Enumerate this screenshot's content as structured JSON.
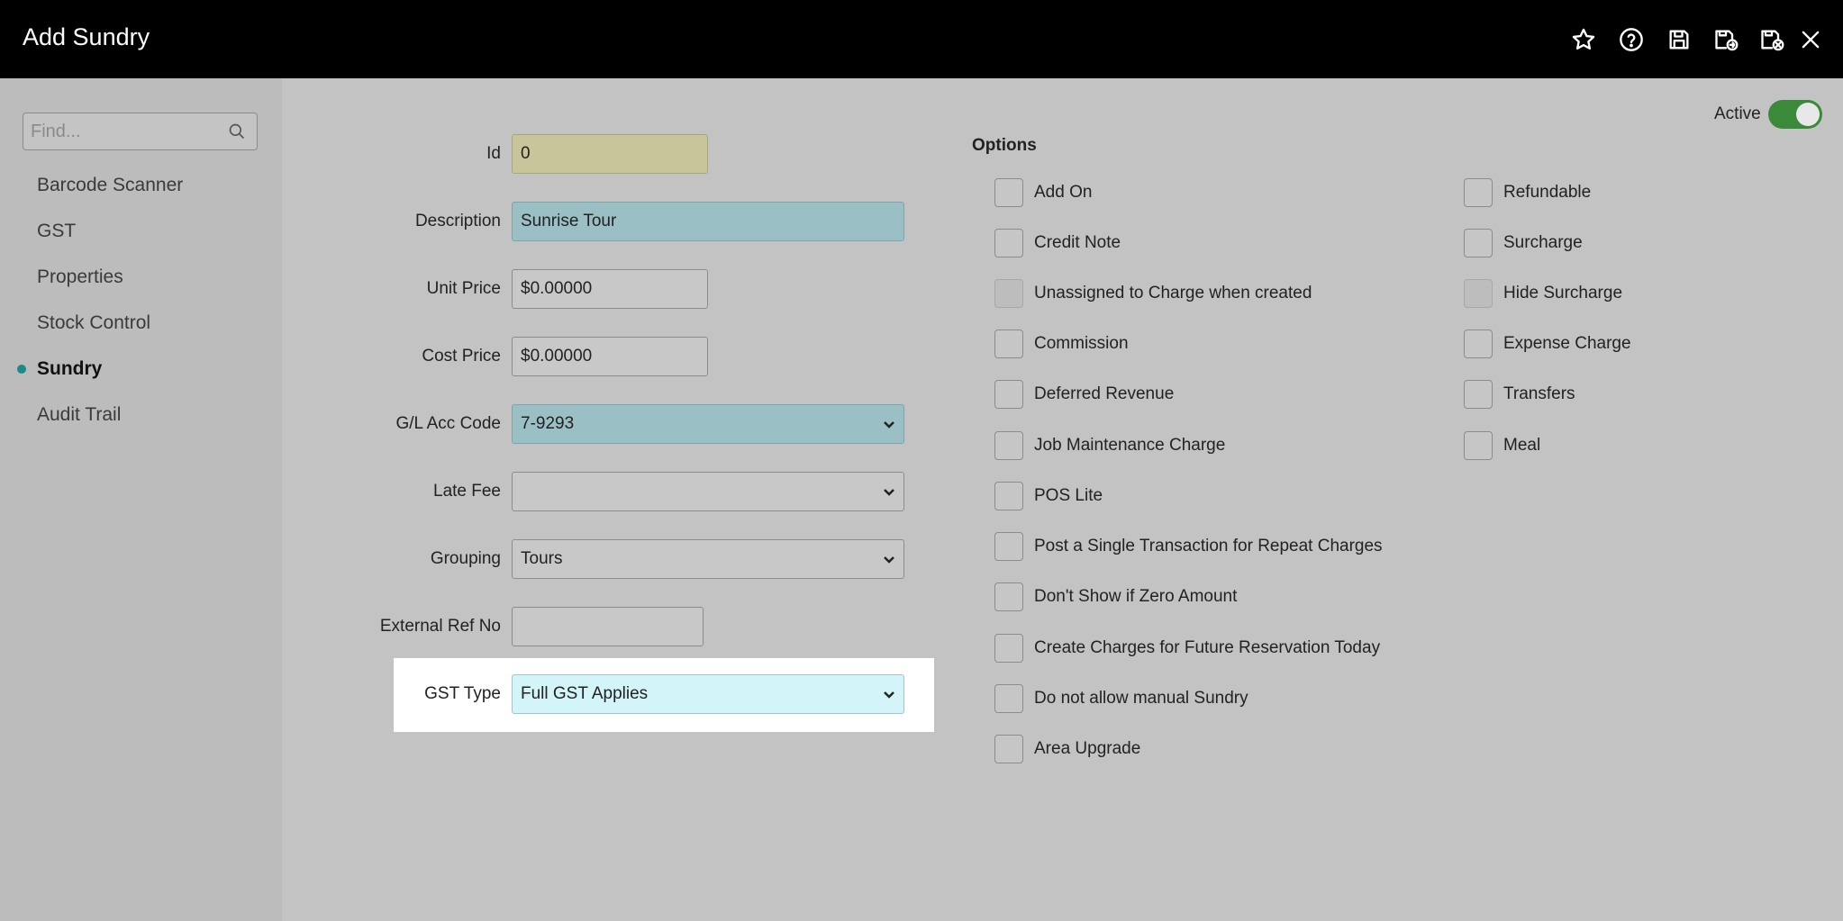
{
  "header": {
    "title": "Add Sundry",
    "icons": [
      "star-icon",
      "help-icon",
      "save-icon",
      "save-and-new-icon",
      "save-and-close-icon",
      "close-icon"
    ]
  },
  "sidebar": {
    "search_placeholder": "Find...",
    "items": [
      {
        "label": "Barcode Scanner",
        "active": false
      },
      {
        "label": "GST",
        "active": false
      },
      {
        "label": "Properties",
        "active": false
      },
      {
        "label": "Stock Control",
        "active": false
      },
      {
        "label": "Sundry",
        "active": true
      },
      {
        "label": "Audit Trail",
        "active": false
      }
    ]
  },
  "form": {
    "id": {
      "label": "Id",
      "value": "0"
    },
    "description": {
      "label": "Description",
      "value": "Sunrise Tour"
    },
    "unit_price": {
      "label": "Unit Price",
      "value": "$0.00000"
    },
    "cost_price": {
      "label": "Cost Price",
      "value": "$0.00000"
    },
    "gl_acc_code": {
      "label": "G/L Acc Code",
      "value": "7-9293"
    },
    "late_fee": {
      "label": "Late Fee",
      "value": ""
    },
    "grouping": {
      "label": "Grouping",
      "value": "Tours"
    },
    "external_ref": {
      "label": "External Ref No",
      "value": ""
    },
    "gst_type": {
      "label": "GST Type",
      "value": "Full GST Applies"
    }
  },
  "active": {
    "label": "Active",
    "on": true
  },
  "options": {
    "title": "Options",
    "left": [
      {
        "label": "Add On",
        "checked": false,
        "disabled": false
      },
      {
        "label": "Credit Note",
        "checked": false,
        "disabled": false
      },
      {
        "label": "Unassigned to Charge when created",
        "checked": false,
        "disabled": true
      },
      {
        "label": "Commission",
        "checked": false,
        "disabled": false
      },
      {
        "label": "Deferred Revenue",
        "checked": false,
        "disabled": false
      },
      {
        "label": "Job Maintenance Charge",
        "checked": false,
        "disabled": false
      },
      {
        "label": "POS Lite",
        "checked": false,
        "disabled": false
      },
      {
        "label": "Post a Single Transaction for Repeat Charges",
        "checked": false,
        "disabled": false
      },
      {
        "label": "Don't Show if Zero Amount",
        "checked": false,
        "disabled": false
      },
      {
        "label": "Create Charges for Future Reservation Today",
        "checked": false,
        "disabled": false
      },
      {
        "label": "Do not allow manual Sundry",
        "checked": false,
        "disabled": false
      },
      {
        "label": "Area Upgrade",
        "checked": false,
        "disabled": false
      }
    ],
    "right": [
      {
        "label": "Refundable",
        "checked": false,
        "disabled": false
      },
      {
        "label": "Surcharge",
        "checked": false,
        "disabled": false
      },
      {
        "label": "Hide Surcharge",
        "checked": false,
        "disabled": true
      },
      {
        "label": "Expense Charge",
        "checked": false,
        "disabled": false
      },
      {
        "label": "Transfers",
        "checked": false,
        "disabled": false
      },
      {
        "label": "Meal",
        "checked": false,
        "disabled": false
      }
    ]
  }
}
